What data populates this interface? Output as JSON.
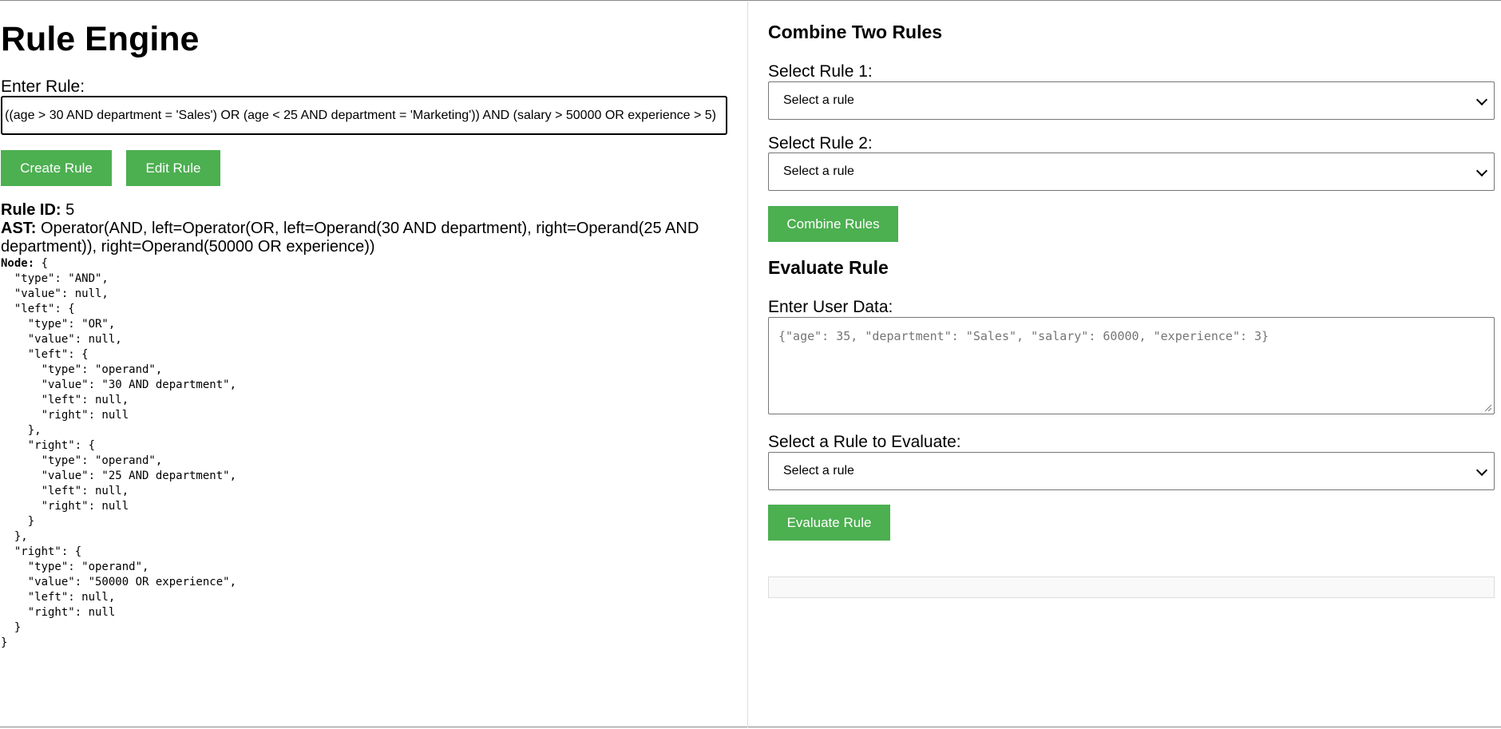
{
  "app": {
    "title": "Rule Engine"
  },
  "create": {
    "label": "Enter Rule:",
    "rule_value": "((age > 30 AND department = 'Sales') OR (age < 25 AND department = 'Marketing')) AND (salary > 50000 OR experience > 5)",
    "create_button": "Create Rule",
    "edit_button": "Edit Rule"
  },
  "result": {
    "rule_id_label": "Rule ID:",
    "rule_id": "5",
    "ast_label": "AST:",
    "ast": "Operator(AND, left=Operator(OR, left=Operand(30 AND department), right=Operand(25 AND department)), right=Operand(50000 OR experience))",
    "node_label": "Node:",
    "node_json": " {\n  \"type\": \"AND\",\n  \"value\": null,\n  \"left\": {\n    \"type\": \"OR\",\n    \"value\": null,\n    \"left\": {\n      \"type\": \"operand\",\n      \"value\": \"30 AND department\",\n      \"left\": null,\n      \"right\": null\n    },\n    \"right\": {\n      \"type\": \"operand\",\n      \"value\": \"25 AND department\",\n      \"left\": null,\n      \"right\": null\n    }\n  },\n  \"right\": {\n    \"type\": \"operand\",\n    \"value\": \"50000 OR experience\",\n    \"left\": null,\n    \"right\": null\n  }\n}"
  },
  "combine": {
    "title": "Combine Two Rules",
    "rule1_label": "Select Rule 1:",
    "rule1_selected": "Select a rule",
    "rule2_label": "Select Rule 2:",
    "rule2_selected": "Select a rule",
    "button": "Combine Rules"
  },
  "evaluate": {
    "title": "Evaluate Rule",
    "data_label": "Enter User Data:",
    "data_placeholder": "{\"age\": 35, \"department\": \"Sales\", \"salary\": 60000, \"experience\": 3}",
    "rule_label": "Select a Rule to Evaluate:",
    "rule_selected": "Select a rule",
    "button": "Evaluate Rule",
    "result": ""
  },
  "colors": {
    "button_bg": "#4caf50",
    "button_text": "#ffffff"
  }
}
